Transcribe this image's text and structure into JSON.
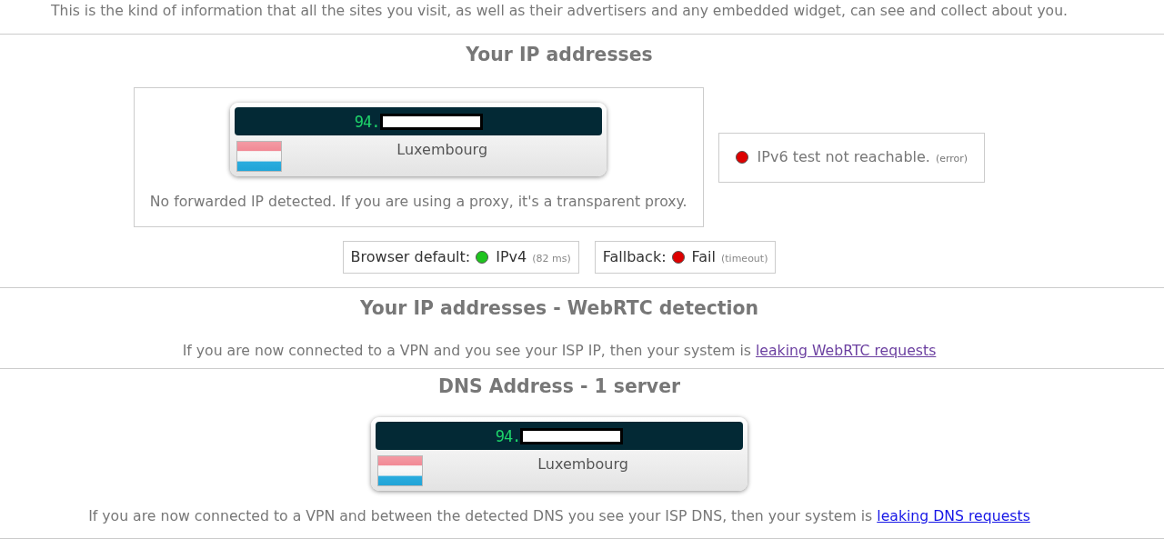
{
  "intro": "This is the kind of information that all the sites you visit, as well as their advertisers and any embedded widget, can see and collect about you.",
  "ip_section": {
    "heading": "Your IP addresses",
    "addresses": [
      {
        "ip": "94.",
        "country": "Luxembourg"
      }
    ],
    "note": "No forwarded IP detected. If you are using a proxy, it's a transparent proxy.",
    "ipv6": {
      "color": "#dd0000",
      "text": "IPv6 test not reachable.",
      "detail": "(error)"
    },
    "tests": [
      {
        "label": "Browser default:",
        "color": "#1fc41f",
        "result": "IPv4",
        "detail": "(82 ms)"
      },
      {
        "label": "Fallback:",
        "color": "#dd0000",
        "result": "Fail",
        "detail": "(timeout)"
      }
    ]
  },
  "webrtc_section": {
    "heading": "Your IP addresses - WebRTC detection",
    "text": "If you are now connected to a VPN and you see your ISP IP, then your system is",
    "link": {
      "text": "leaking WebRTC requests",
      "visited": true
    }
  },
  "dns_section": {
    "heading": "DNS Address - 1 server",
    "servers": [
      {
        "ip": "94.",
        "country": "Luxembourg"
      }
    ],
    "text": "If you are now connected to a VPN and between the detected DNS you see your ISP DNS, then your system is",
    "link": {
      "text": "leaking DNS requests",
      "visited": false
    }
  }
}
